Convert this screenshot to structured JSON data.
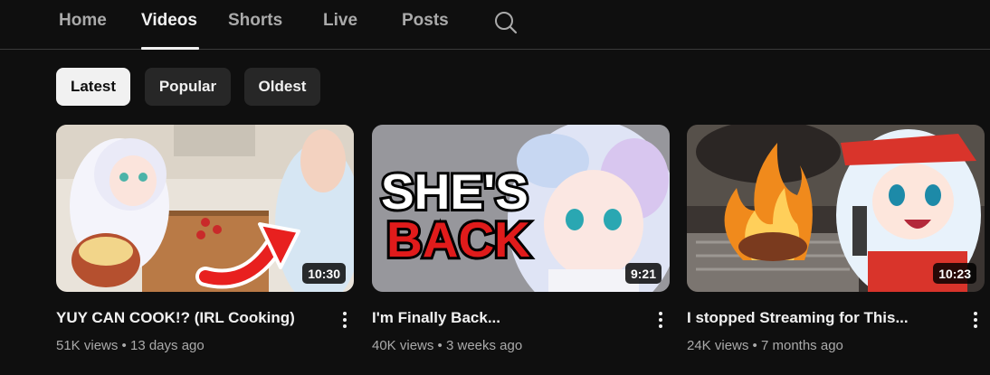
{
  "tabs": [
    {
      "label": "Home",
      "active": false
    },
    {
      "label": "Videos",
      "active": true
    },
    {
      "label": "Shorts",
      "active": false
    },
    {
      "label": "Live",
      "active": false
    },
    {
      "label": "Posts",
      "active": false
    }
  ],
  "search": {
    "icon": "search-icon"
  },
  "chips": [
    {
      "label": "Latest",
      "selected": true
    },
    {
      "label": "Popular",
      "selected": false
    },
    {
      "label": "Oldest",
      "selected": false
    }
  ],
  "videos": [
    {
      "title": "YUY CAN COOK!? (IRL Cooking)",
      "views": "51K views",
      "age": "13 days ago",
      "duration": "10:30",
      "menu_icon": "more-vert-icon"
    },
    {
      "title": "I'm Finally Back...",
      "views": "40K views",
      "age": "3 weeks ago",
      "duration": "9:21",
      "thumb_text_1": "SHE'S",
      "thumb_text_2": "BACK",
      "menu_icon": "more-vert-icon"
    },
    {
      "title": "I stopped Streaming for This...",
      "views": "24K views",
      "age": "7 months ago",
      "duration": "10:23",
      "menu_icon": "more-vert-icon"
    }
  ],
  "meta_separator": "•",
  "colors": {
    "background": "#0f0f0f",
    "chip_bg": "#272727",
    "chip_selected_bg": "#f1f1f1",
    "text_primary": "#f1f1f1",
    "text_secondary": "#aaaaaa",
    "arrow_red": "#e8201f"
  }
}
